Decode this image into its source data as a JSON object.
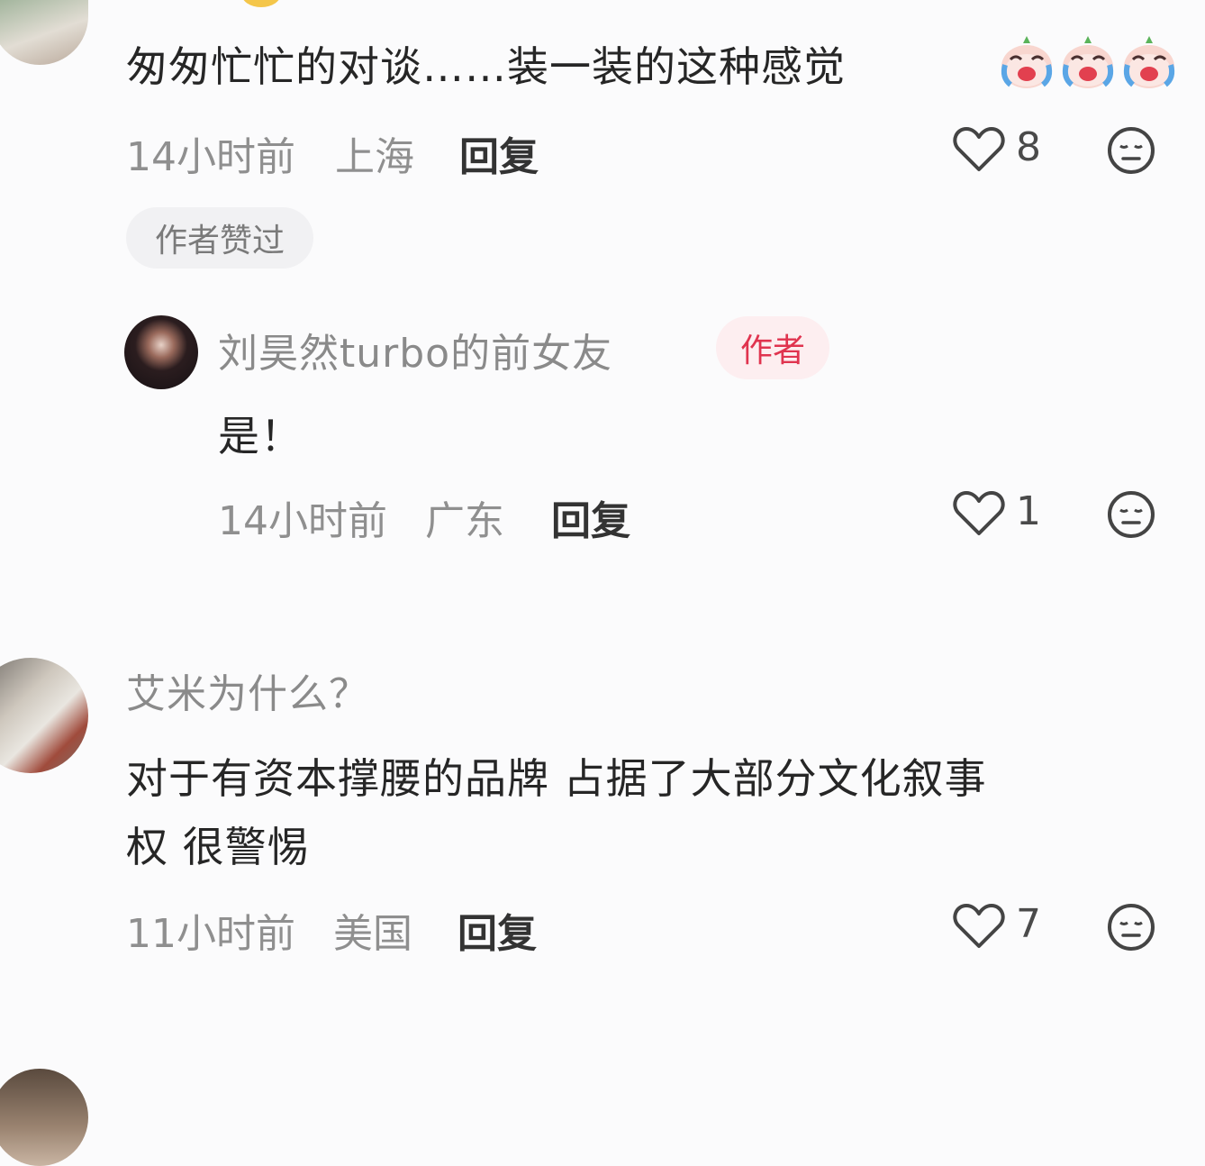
{
  "comments": [
    {
      "text": "匆匆忙忙的对谈……装一装的这种感觉",
      "time": "14小时前",
      "location": "上海",
      "reply_label": "回复",
      "likes": "8",
      "liked_by_author_label": "作者赞过",
      "reply": {
        "username": "刘昊然turbo的前女友",
        "author_badge": "作者",
        "text": "是！",
        "time": "14小时前",
        "location": "广东",
        "reply_label": "回复",
        "likes": "1"
      }
    },
    {
      "username": "艾米为什么？",
      "text_line1": "对于有资本撑腰的品牌 占据了大部分文化叙事",
      "text_line2": "权 很警惕",
      "time": "11小时前",
      "location": "美国",
      "reply_label": "回复",
      "likes": "7"
    }
  ],
  "colors": {
    "background": "#fbfbfc",
    "author_badge_text": "#e0344f",
    "author_badge_bg": "#fdeef0"
  },
  "icons": [
    "laughing-crying-emoji",
    "heart-icon",
    "dislike-face-icon"
  ]
}
